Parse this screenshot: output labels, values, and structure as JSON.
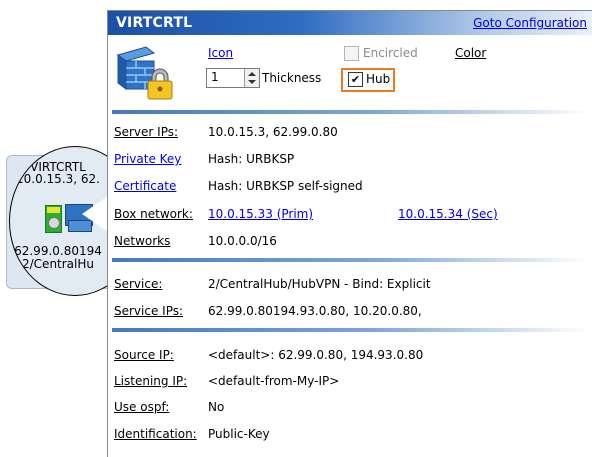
{
  "node": {
    "name": "VIRTCRTL",
    "ip": "10.0.15.3, 62.",
    "wan": "62.99.0.80194",
    "hub": "2/CentralHu"
  },
  "panel": {
    "title": "VIRTCRTL",
    "goto_label": "Goto Configuration",
    "icon_label": "Icon",
    "encircled_label": "Encircled",
    "encircled_checked": false,
    "color_label": "Color",
    "thickness_value": "1",
    "thickness_label": "Thickness",
    "hub_label": "Hub",
    "hub_checked": true
  },
  "section1": {
    "server_ips_label": "Server IPs:",
    "server_ips_value": "10.0.15.3, 62.99.0.80",
    "private_key_label": "Private Key",
    "private_key_value": "Hash: URBKSP",
    "certificate_label": "Certificate",
    "certificate_value": "Hash: URBKSP self-signed",
    "box_network_label": "Box network:",
    "box_network_prim": "10.0.15.33 (Prim)",
    "box_network_sec": "10.0.15.34 (Sec)",
    "networks_label": "Networks",
    "networks_value": "10.0.0.0/16"
  },
  "section2": {
    "service_label": "Service:",
    "service_value": "2/CentralHub/HubVPN - Bind: Explicit",
    "service_ips_label": "Service IPs:",
    "service_ips_value": "62.99.0.80194.93.0.80, 10.20.0.80,"
  },
  "section3": {
    "source_ip_label": "Source IP:",
    "source_ip_value": "<default>: 62.99.0.80, 194.93.0.80",
    "listening_ip_label": "Listening IP:",
    "listening_ip_value": "<default-from-My-IP>",
    "use_ospf_label": "Use ospf:",
    "use_ospf_value": "No",
    "identification_label": "Identification:",
    "identification_value": "Public-Key"
  },
  "icons": {
    "firewall": "firewall-lock-icon",
    "gateway": "gateway-icon"
  },
  "colors": {
    "title_bar": "#1d4fa8",
    "link": "#0000ee",
    "hub_highlight": "#f0781e"
  }
}
